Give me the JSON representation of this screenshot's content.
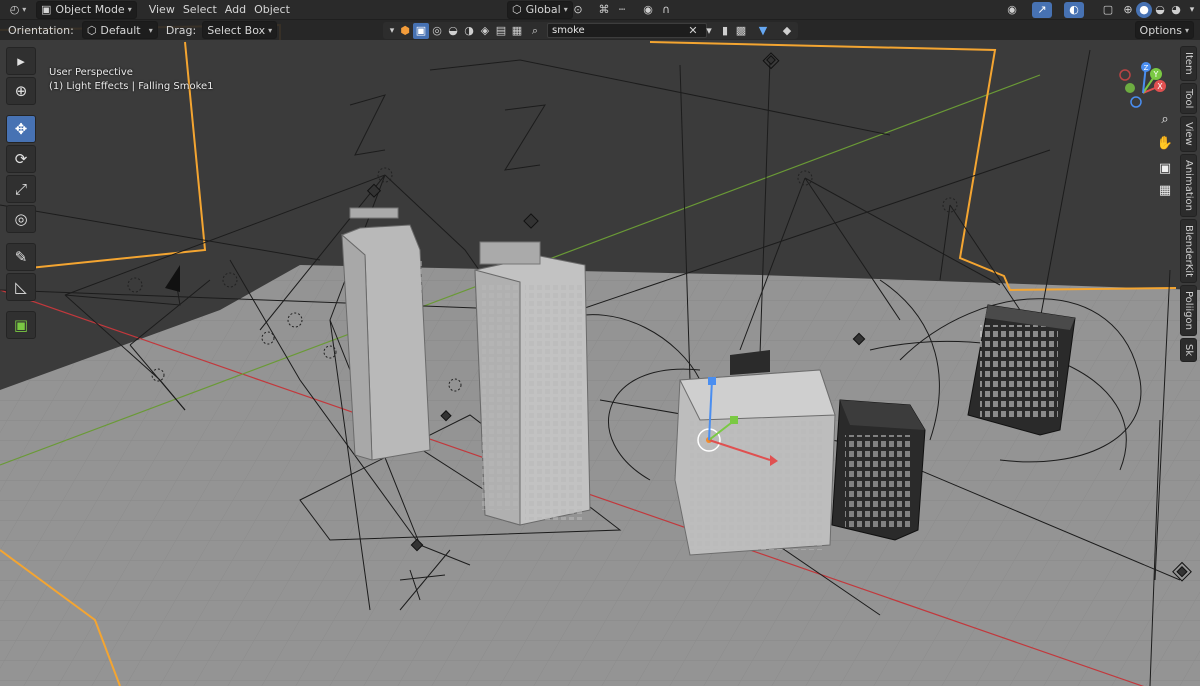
{
  "header": {
    "editor_type_icon": "3d-viewport-icon",
    "mode": "Object Mode",
    "menus": [
      "View",
      "Select",
      "Add",
      "Object"
    ],
    "transform_orientation": "Global",
    "right_icons": [
      "visibility-icon",
      "gizmo-icon",
      "overlay-icon",
      "xray-icon",
      "shading-wireframe-icon",
      "shading-solid-icon",
      "shading-material-icon",
      "shading-rendered-icon"
    ]
  },
  "tool_settings": {
    "orientation_label": "Orientation:",
    "orientation_value": "Default",
    "drag_label": "Drag:",
    "drag_value": "Select Box",
    "options_label": "Options"
  },
  "search": {
    "value": "smoke",
    "icons": [
      "filter-mesh-icon",
      "filter-curve-icon",
      "filter-light-icon",
      "filter-camera-icon",
      "filter-empty-icon",
      "filter-other-icon"
    ]
  },
  "viewport": {
    "perspective": "User Perspective",
    "context": "(1) Light Effects | Falling Smoke1",
    "colors": {
      "ground": "#8f8f8f",
      "sky": "#3c3c3c",
      "selection_outline": "#f4a531",
      "x_axis": "#c2383c",
      "y_axis": "#6a9a36"
    }
  },
  "toolbar": {
    "tools": [
      "select-box-icon",
      "cursor-icon",
      "move-icon",
      "rotate-icon",
      "scale-icon",
      "transform-icon",
      "annotate-icon",
      "measure-icon",
      "add-cube-icon"
    ]
  },
  "gizmo": {
    "axes": [
      "X",
      "Y",
      "Z"
    ]
  },
  "navigation": [
    "zoom-icon",
    "pan-icon",
    "camera-view-icon",
    "perspective-toggle-icon"
  ],
  "sidebar_tabs": [
    "Item",
    "Tool",
    "View",
    "Animation",
    "BlenderKit",
    "Poliigon",
    "Sk"
  ]
}
